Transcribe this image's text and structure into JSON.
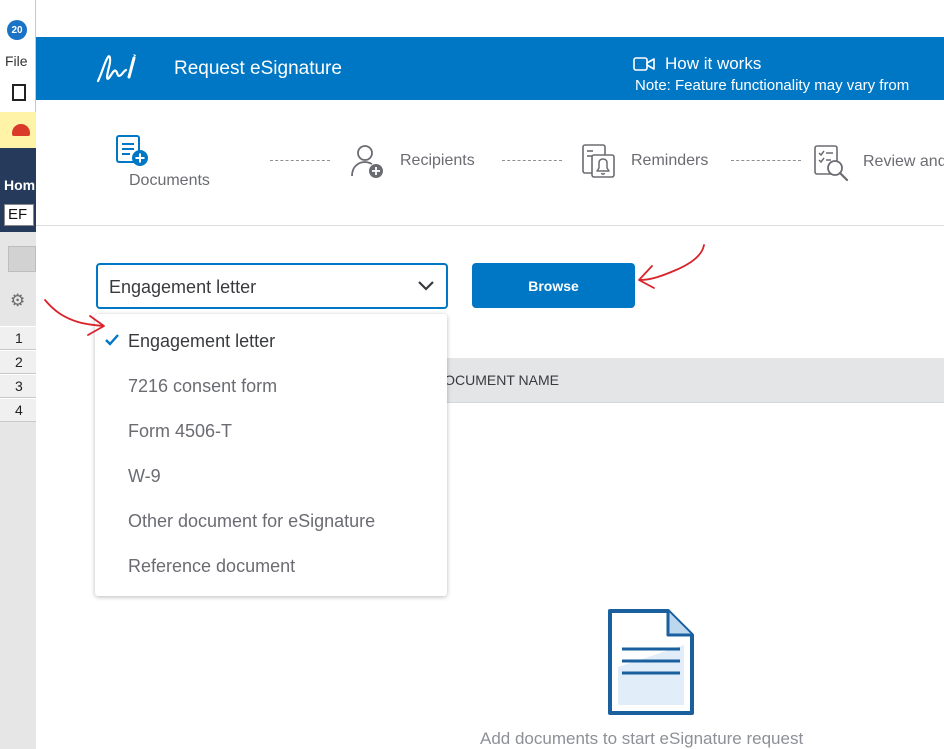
{
  "background_app": {
    "logo_text": "20",
    "menu_file": "File",
    "home_label": "Hom",
    "ef_field": "EF",
    "row_numbers": [
      "1",
      "2",
      "3",
      "4"
    ]
  },
  "header": {
    "title": "Request eSignature",
    "how_it_works": "How it works",
    "note": "Note: Feature functionality may vary from"
  },
  "stepper": {
    "steps": [
      {
        "label": "Documents",
        "active": true,
        "icon": "documents-add-icon"
      },
      {
        "label": "Recipients",
        "active": false,
        "icon": "recipient-add-icon"
      },
      {
        "label": "Reminders",
        "active": false,
        "icon": "reminder-bell-icon"
      },
      {
        "label": "Review and",
        "active": false,
        "icon": "review-search-icon"
      }
    ]
  },
  "document_select": {
    "value": "Engagement letter",
    "options": [
      {
        "label": "Engagement letter",
        "selected": true
      },
      {
        "label": "7216 consent form",
        "selected": false
      },
      {
        "label": "Form 4506-T",
        "selected": false
      },
      {
        "label": "W-9",
        "selected": false
      },
      {
        "label": "Other document for eSignature",
        "selected": false
      },
      {
        "label": "Reference document",
        "selected": false
      }
    ]
  },
  "browse_button": "Browse",
  "table": {
    "column_document_name": "DOCUMENT NAME"
  },
  "empty_state": {
    "message": "Add documents to start eSignature request"
  },
  "colors": {
    "primary": "#0077c5",
    "annotation": "#d9232b"
  }
}
